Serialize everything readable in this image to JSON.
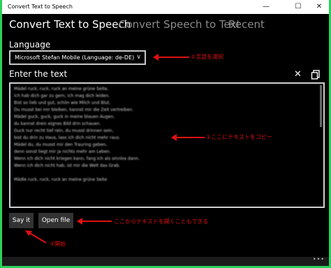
{
  "window": {
    "title": "Convert Text to Speech",
    "controls": {
      "minimize": "—",
      "maximize": "☐",
      "close": "✕"
    }
  },
  "tabs": [
    {
      "label": "Convert Text to Speech",
      "active": true
    },
    {
      "label": "Convert Speech to Text",
      "active": false
    },
    {
      "label": "Recent",
      "active": false
    }
  ],
  "language": {
    "label": "Language",
    "selected": "Microsoft Stefan Mobile (Language: de-DE)"
  },
  "input": {
    "label": "Enter the text",
    "lines": [
      "Mädel ruck, ruck, ruck an meine grüne Seite,",
      "ich hab dich gar zu gern, ich mag dich leiden.",
      "Bist so lieb und gut, schön wie Milch und Blut,",
      "Du musst bei mir bleiben, kannst mir die Zeit vertreiben.",
      "Mädel guck, guck, guck in meine blauen Augen,",
      "du kannst drein eignes Bild drin schauen.",
      "Guck nur recht tief rein, du musst drinnen sein,",
      "bist du drin zu Haus, lass ich dich nicht mehr raus.",
      "Mädel du, du musst mir den Trauring geben,",
      "denn sonst liegt mir ja nichts mehr am Leben.",
      "Wenn ich dich nicht kriegen kann, fang ich als sinnlos dann.",
      "Wenn ich dich nicht hab, ist mir die Welt das Grab.",
      "",
      "Mädle ruck, ruck, ruck an meine grüne Seite"
    ]
  },
  "buttons": {
    "say_it": "Say it",
    "open_file": "Open file"
  },
  "annotations": {
    "select_language": "②言語を選択",
    "copy_text": "①ここにテキストをコピー",
    "open_file": "ここからテキストを開くこともできる",
    "start": "③開始"
  },
  "status": {
    "more": "•••"
  },
  "colors": {
    "annotation": "#e01010",
    "background": "#000000",
    "border": "#2bd05a"
  }
}
